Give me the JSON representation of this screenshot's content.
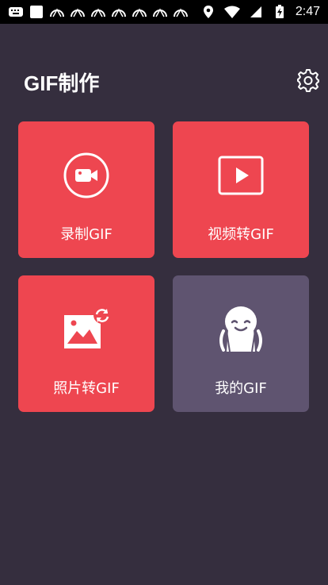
{
  "status_bar": {
    "time": "2:47",
    "left_icons": [
      "keyboard-icon",
      "square-icon",
      "app-icon",
      "app-icon",
      "app-icon",
      "app-icon",
      "app-icon",
      "app-icon",
      "app-icon"
    ],
    "right_icons": [
      "location-icon",
      "wifi-icon",
      "signal-icon",
      "battery-icon"
    ]
  },
  "header": {
    "title": "GIF制作"
  },
  "tiles": [
    {
      "label": "录制GIF",
      "icon": "video-camera-icon",
      "color": "#ee4650"
    },
    {
      "label": "视频转GIF",
      "icon": "play-icon",
      "color": "#ee4650"
    },
    {
      "label": "照片转GIF",
      "icon": "photo-icon",
      "color": "#ee4650"
    },
    {
      "label": "我的GIF",
      "icon": "person-icon",
      "color": "#5f5470"
    }
  ],
  "colors": {
    "background": "#352e3e",
    "accent": "#ee4650",
    "tile_secondary": "#5f5470"
  }
}
